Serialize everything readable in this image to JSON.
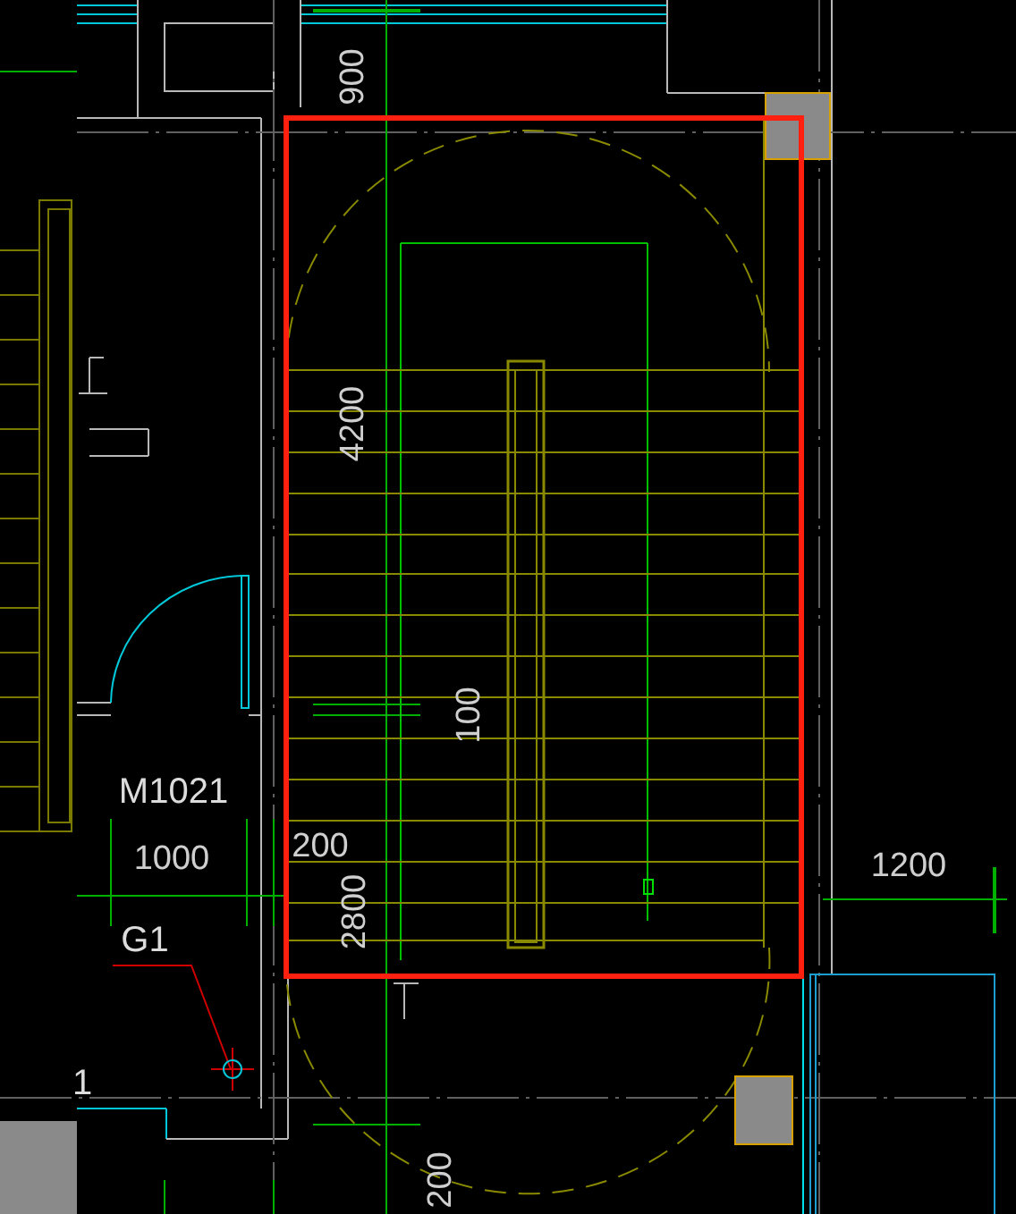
{
  "canvas": {
    "labels": [
      {
        "text": "900",
        "kind": "dimension"
      },
      {
        "text": "4200",
        "kind": "dimension"
      },
      {
        "text": "100",
        "kind": "dimension"
      },
      {
        "text": "M1021",
        "kind": "tag"
      },
      {
        "text": "1000",
        "kind": "dimension"
      },
      {
        "text": "200",
        "kind": "dimension"
      },
      {
        "text": "2800",
        "kind": "dimension"
      },
      {
        "text": "1200",
        "kind": "dimension"
      },
      {
        "text": "G1",
        "kind": "tag"
      },
      {
        "text": "1",
        "kind": "tag"
      },
      {
        "text": "200",
        "kind": "dimension"
      }
    ]
  }
}
